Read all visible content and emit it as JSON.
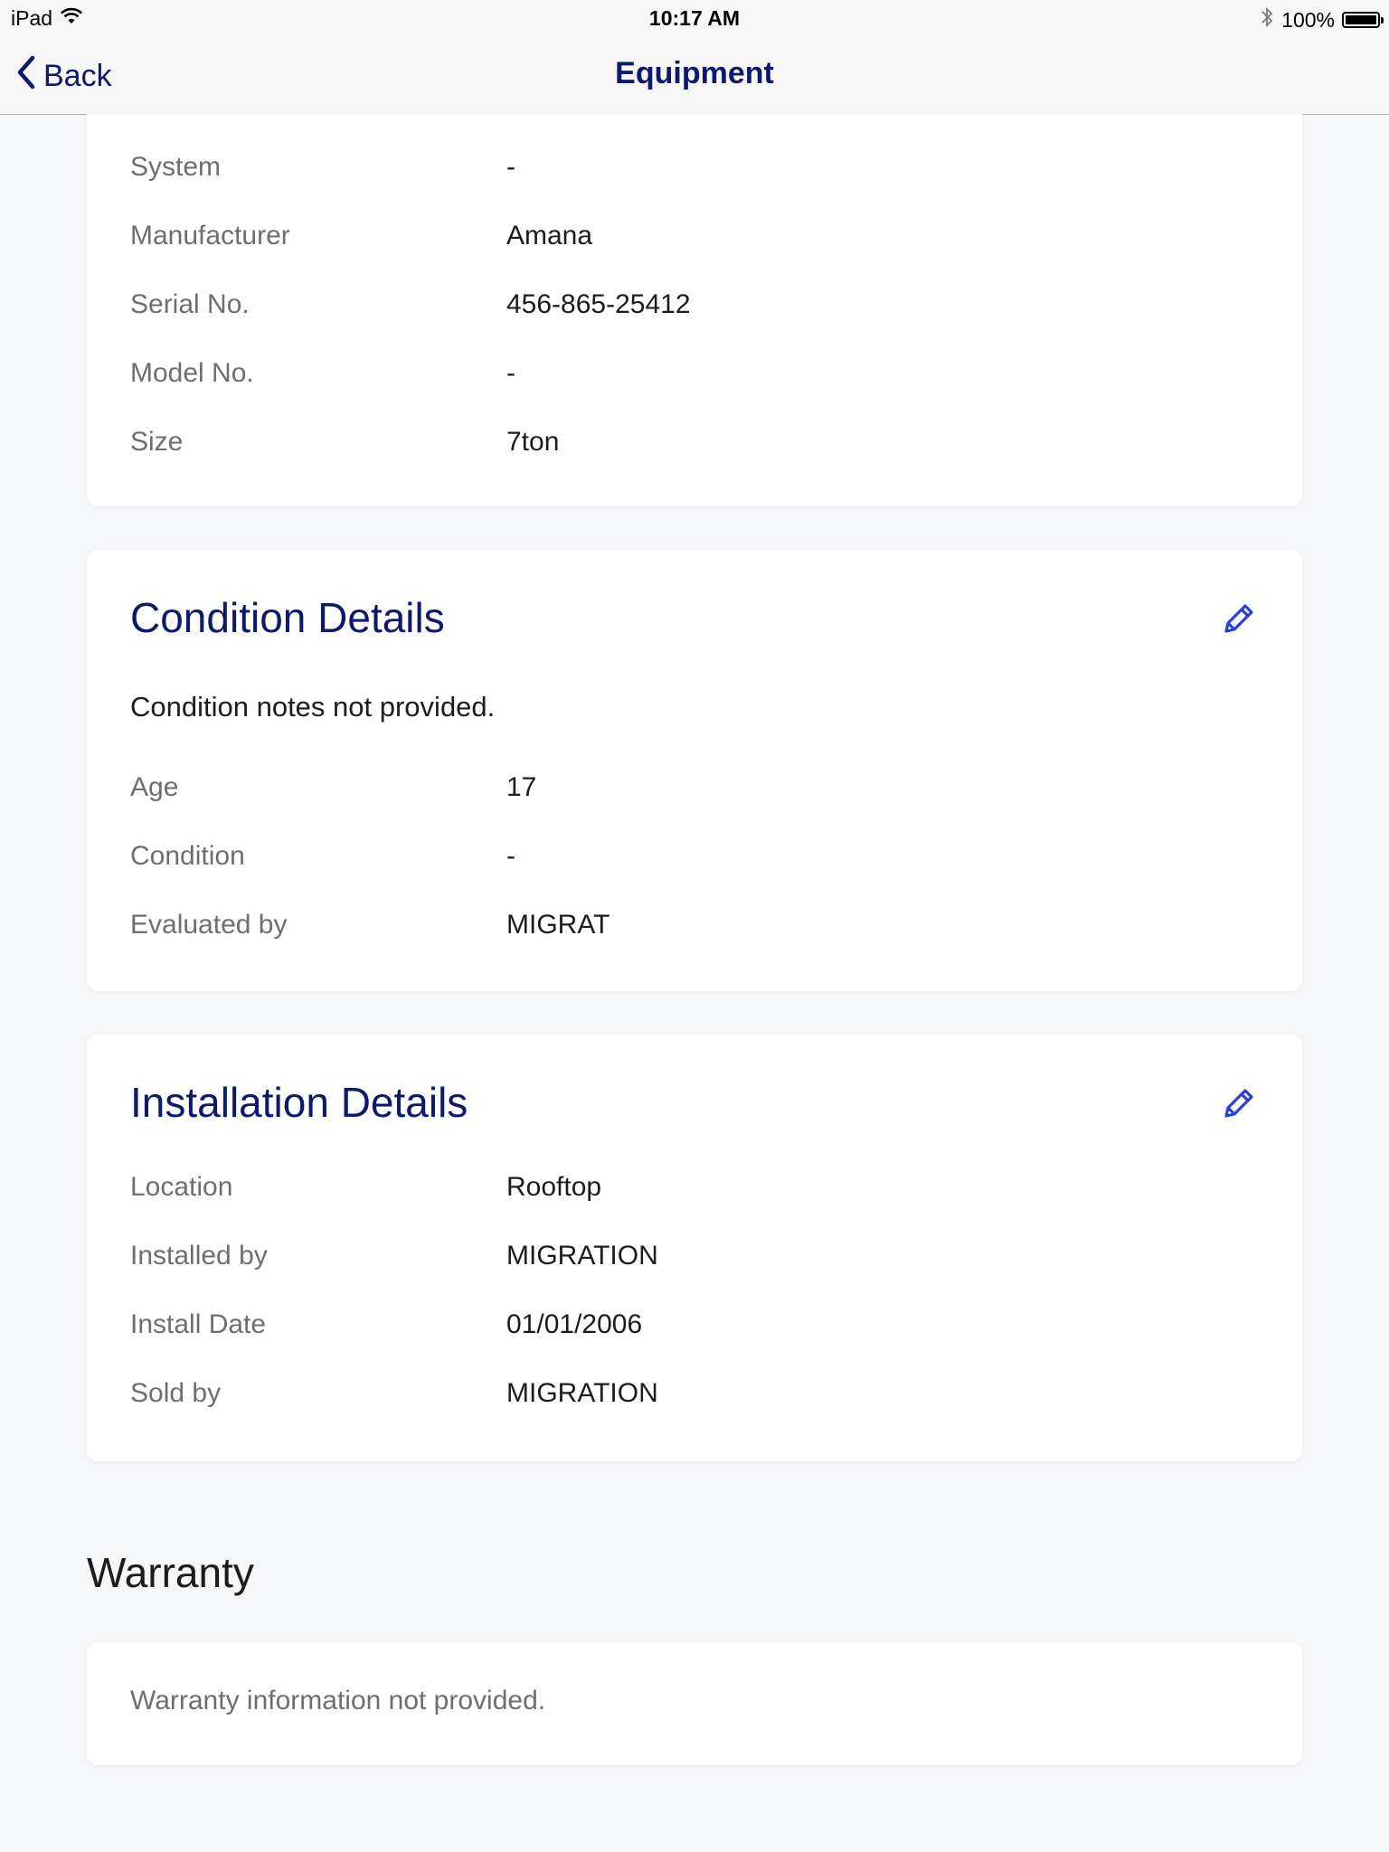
{
  "status_bar": {
    "device": "iPad",
    "time": "10:17 AM",
    "battery": "100%",
    "battery_level": 1.0
  },
  "nav": {
    "back_label": "Back",
    "title": "Equipment"
  },
  "equipment": {
    "rows": [
      {
        "label": "System",
        "value": "-"
      },
      {
        "label": "Manufacturer",
        "value": "Amana"
      },
      {
        "label": "Serial No.",
        "value": "456-865-25412"
      },
      {
        "label": "Model No.",
        "value": "-"
      },
      {
        "label": "Size",
        "value": "7ton"
      }
    ]
  },
  "condition": {
    "title": "Condition Details",
    "note": "Condition notes not provided.",
    "rows": [
      {
        "label": "Age",
        "value": "17"
      },
      {
        "label": "Condition",
        "value": "-"
      },
      {
        "label": "Evaluated by",
        "value": "MIGRAT"
      }
    ]
  },
  "installation": {
    "title": "Installation Details",
    "rows": [
      {
        "label": "Location",
        "value": "Rooftop"
      },
      {
        "label": "Installed by",
        "value": "MIGRATION"
      },
      {
        "label": "Install Date",
        "value": "01/01/2006"
      },
      {
        "label": "Sold by",
        "value": "MIGRATION"
      }
    ]
  },
  "warranty": {
    "heading": "Warranty",
    "note": "Warranty information not provided."
  },
  "colors": {
    "accent": "#0d1a6b",
    "edit_icon": "#2a3fd6",
    "background": "#f5f6f8"
  },
  "icons": {
    "back": "chevron-left-icon",
    "edit": "pencil-icon",
    "wifi": "wifi-icon",
    "bluetooth": "bluetooth-icon",
    "battery": "battery-icon"
  }
}
